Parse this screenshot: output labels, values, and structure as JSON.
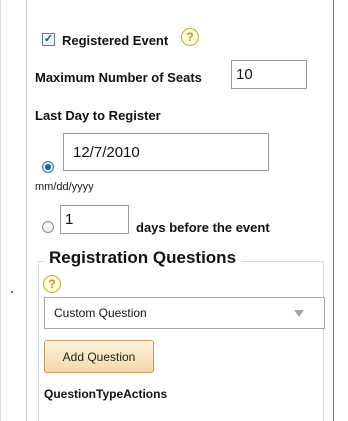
{
  "registered_event": {
    "label": "Registered Event",
    "checked": true,
    "help_icon": "question-mark-icon"
  },
  "maximum_seats": {
    "label": "Maximum Number of Seats",
    "value": "10"
  },
  "last_day": {
    "label": "Last Day to Register",
    "date_value": "12/7/2010",
    "date_format": "mm/dd/yyyy",
    "days_value": "1",
    "days_suffix": "days before the event"
  },
  "registration_questions": {
    "title": "Registration Questions",
    "help_icon": "question-mark-icon",
    "select_value": "Custom Question",
    "add_button_label": "Add Question",
    "actions_label": "QuestionTypeActions"
  },
  "colors": {
    "button_bg": "#f5d9a9",
    "button_border": "#c39d62",
    "help_icon": "#b59a26",
    "radio_checked": "#245d9c"
  }
}
